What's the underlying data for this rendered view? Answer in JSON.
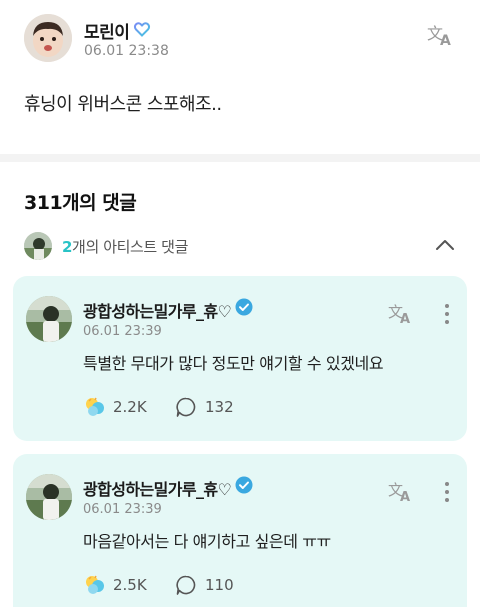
{
  "post": {
    "author": "모린이",
    "date": "06.01 23:38",
    "body": "휴닝이 위버스콘 스포해조..",
    "badge_icon": "heart-badge-icon",
    "translate_icon": "translate-icon"
  },
  "comments_section": {
    "title": "311개의 댓글",
    "artist_count": "2",
    "artist_label_suffix": "개의 아티스트 댓글",
    "collapse_icon": "chevron-up-icon"
  },
  "comments": [
    {
      "author": "광합성하는밀가루_휴♡",
      "date": "06.01 23:39",
      "text": "특별한 무대가 많다 정도만 얘기할 수 있겠네요",
      "likes": "2.2K",
      "replies": "132"
    },
    {
      "author": "광합성하는밀가루_휴♡",
      "date": "06.01 23:39",
      "text": "마음같아서는 다 얘기하고 싶은데 ㅠㅠ",
      "likes": "2.5K",
      "replies": "110"
    }
  ],
  "colors": {
    "accent": "#29c3c6",
    "card_bg": "#e5f8f6",
    "verified": "#3aa8e0"
  }
}
